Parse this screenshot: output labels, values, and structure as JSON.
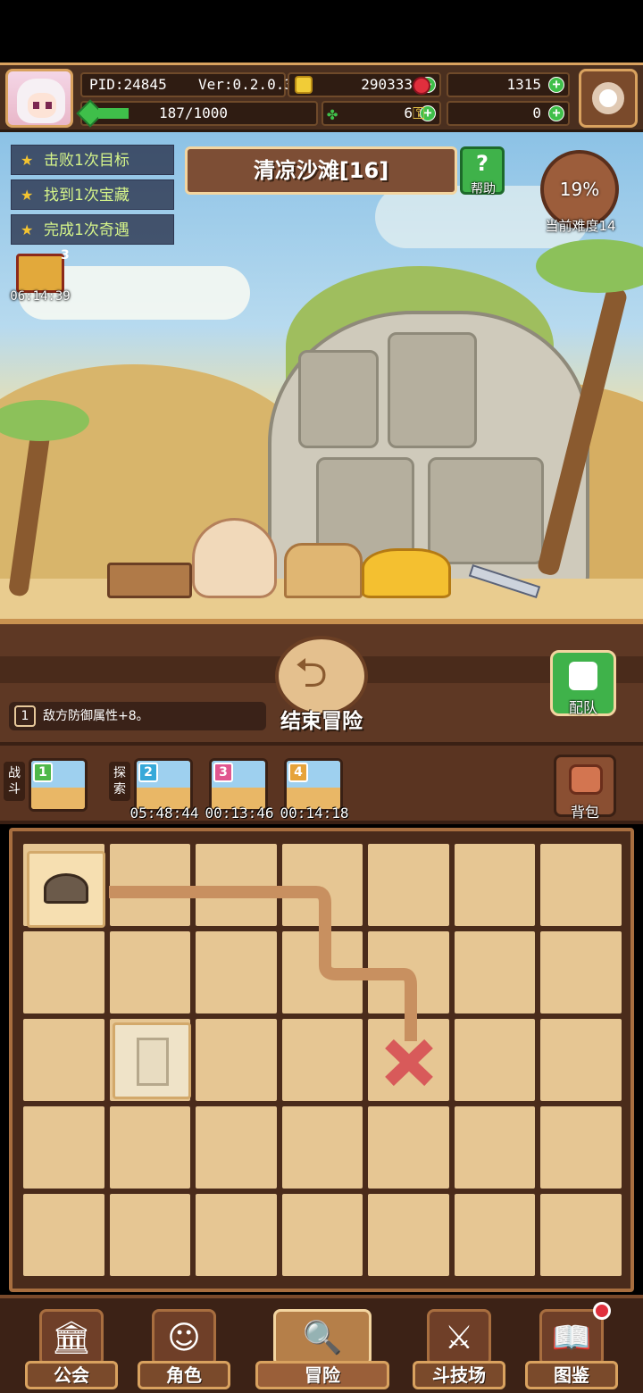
{
  "header": {
    "pid": "PID:24845",
    "version": "Ver:0.2.0.3",
    "gold": "290333",
    "gems": "1315",
    "energy": "187/1000",
    "energy_progress": 0.187,
    "clovers": "6",
    "keys": "0"
  },
  "quests": [
    {
      "label": "击败1次目标"
    },
    {
      "label": "找到1次宝藏"
    },
    {
      "label": "完成1次奇遇"
    }
  ],
  "gift": {
    "count": "3",
    "timer": "06:14:39"
  },
  "stage": {
    "title": "清凉沙滩[16]",
    "help_label": "帮助"
  },
  "difficulty": {
    "percent": "19%",
    "label": "当前难度14"
  },
  "controls": {
    "end_adventure": "结束冒险",
    "team_label": "配队",
    "debuff_index": "1",
    "debuff_text": "敌方防御属性+8。"
  },
  "slots": {
    "battle_label": "战斗",
    "explore_label": "探索",
    "battle_slot": {
      "num": "1",
      "color": "#4fb84a"
    },
    "explore_slots": [
      {
        "num": "2",
        "timer": "05:48:44",
        "color": "#37a9d9"
      },
      {
        "num": "3",
        "timer": "00:13:46",
        "color": "#e0568f"
      },
      {
        "num": "4",
        "timer": "00:14:18",
        "color": "#e6a33a"
      }
    ],
    "bag_label": "背包"
  },
  "nav": [
    {
      "label": "公会",
      "icon": "guild-hall-icon"
    },
    {
      "label": "角色",
      "icon": "character-icon"
    },
    {
      "label": "冒险",
      "icon": "adventure-map-icon",
      "active": true
    },
    {
      "label": "斗技场",
      "icon": "crossed-swords-icon"
    },
    {
      "label": "图鉴",
      "icon": "codex-book-icon"
    }
  ],
  "colors": {
    "accent_green": "#3fb24a",
    "frame_brown": "#7a4a2b",
    "path_color": "#c89060",
    "target_marker": "#d85a5a",
    "quest_text": "#d6f58a"
  }
}
